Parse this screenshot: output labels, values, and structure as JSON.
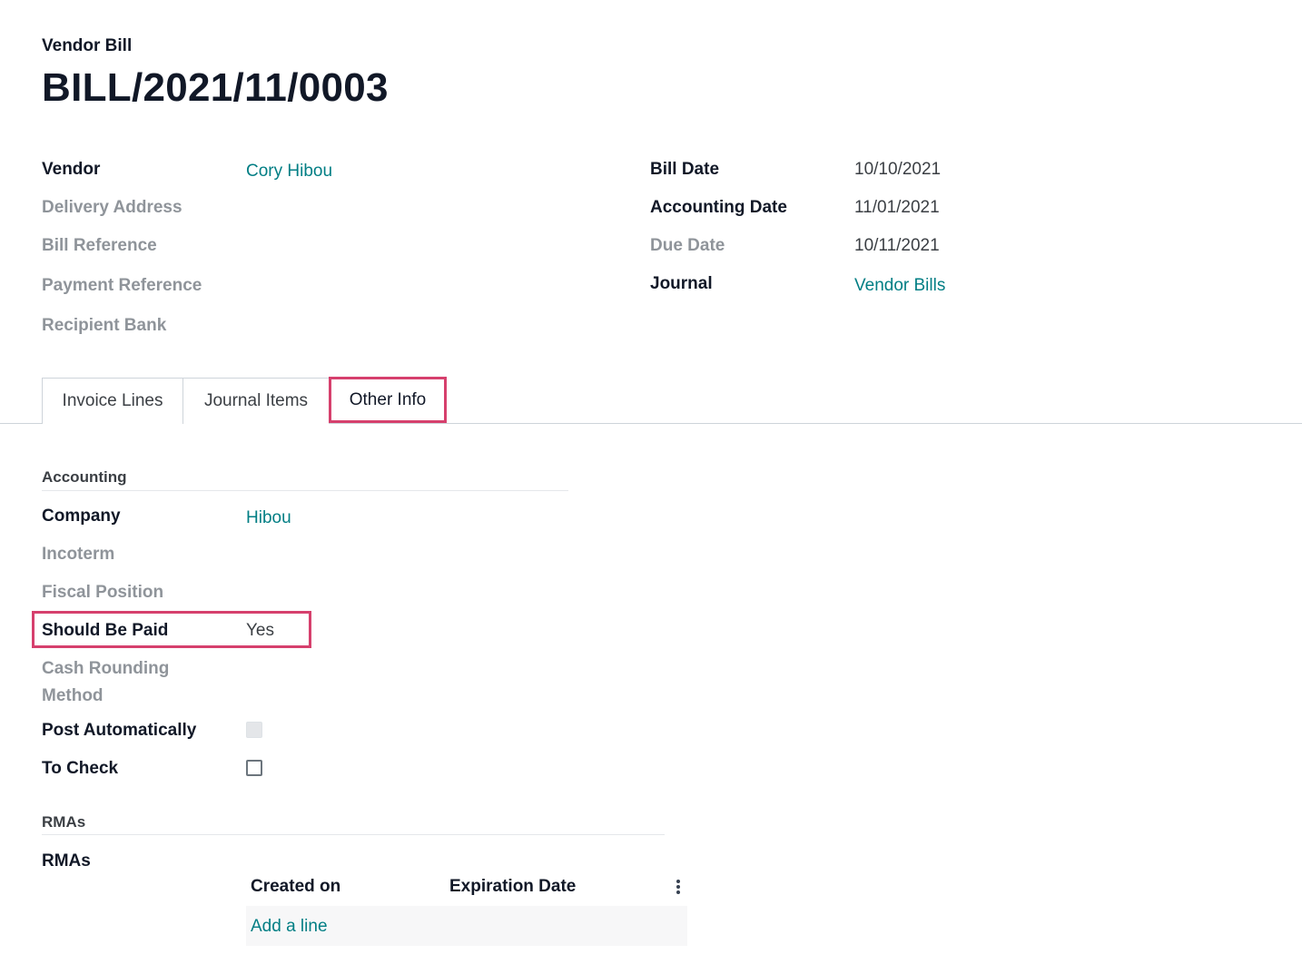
{
  "header": {
    "doc_type": "Vendor Bill",
    "title": "BILL/2021/11/0003"
  },
  "left_fields": {
    "vendor_label": "Vendor",
    "vendor_value": "Cory Hibou",
    "delivery_address_label": "Delivery Address",
    "bill_reference_label": "Bill Reference",
    "payment_reference_label": "Payment Reference",
    "recipient_bank_label": "Recipient Bank"
  },
  "right_fields": {
    "bill_date_label": "Bill Date",
    "bill_date_value": "10/10/2021",
    "accounting_date_label": "Accounting Date",
    "accounting_date_value": "11/01/2021",
    "due_date_label": "Due Date",
    "due_date_value": "10/11/2021",
    "journal_label": "Journal",
    "journal_value": "Vendor Bills"
  },
  "tabs": [
    {
      "label": "Invoice Lines"
    },
    {
      "label": "Journal Items"
    },
    {
      "label": "Other Info"
    }
  ],
  "accounting": {
    "section_title": "Accounting",
    "company_label": "Company",
    "company_value": "Hibou",
    "incoterm_label": "Incoterm",
    "fiscal_position_label": "Fiscal Position",
    "should_be_paid_label": "Should Be Paid",
    "should_be_paid_value": "Yes",
    "cash_rounding_label_1": "Cash Rounding",
    "cash_rounding_label_2": "Method",
    "post_automatically_label": "Post Automatically",
    "post_automatically_checked": false,
    "to_check_label": "To Check",
    "to_check_checked": false
  },
  "rmas": {
    "section_title": "RMAs",
    "field_label": "RMAs",
    "columns": [
      "Created on",
      "Expiration Date"
    ],
    "add_line": "Add a line"
  },
  "colors": {
    "link": "#017e84",
    "highlight": "#d6406d"
  }
}
